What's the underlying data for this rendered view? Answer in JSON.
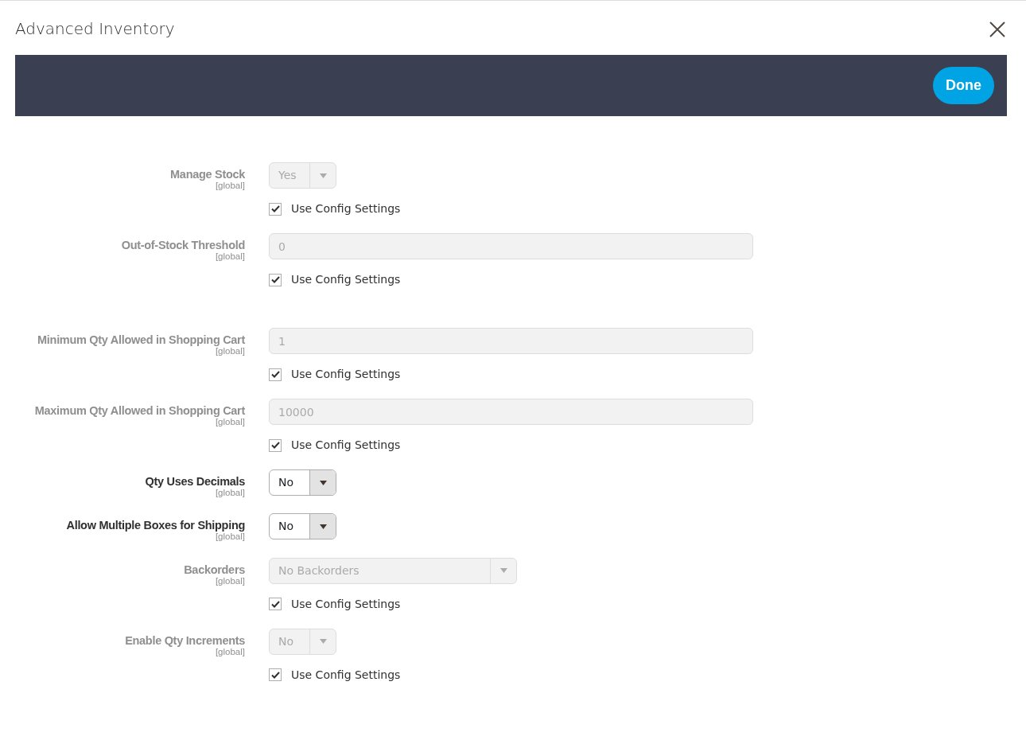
{
  "modal": {
    "title": "Advanced Inventory",
    "done_button": "Done"
  },
  "fields": [
    {
      "label": "Manage Stock",
      "scope": "[global]",
      "kind": "select",
      "value": "Yes",
      "disabled": true,
      "use_config": {
        "label": "Use Config Settings",
        "checked": true
      }
    },
    {
      "label": "Out-of-Stock Threshold",
      "scope": "[global]",
      "kind": "text",
      "value": "0",
      "disabled": true,
      "use_config": {
        "label": "Use Config Settings",
        "checked": true
      }
    },
    {
      "label": "Minimum Qty Allowed in Shopping Cart",
      "scope": "[global]",
      "kind": "text",
      "value": "1",
      "disabled": true,
      "use_config": {
        "label": "Use Config Settings",
        "checked": true
      }
    },
    {
      "label": "Maximum Qty Allowed in Shopping Cart",
      "scope": "[global]",
      "kind": "text",
      "value": "10000",
      "disabled": true,
      "use_config": {
        "label": "Use Config Settings",
        "checked": true
      }
    },
    {
      "label": "Qty Uses Decimals",
      "scope": "[global]",
      "kind": "select",
      "value": "No",
      "disabled": false
    },
    {
      "label": "Allow Multiple Boxes for Shipping",
      "scope": "[global]",
      "kind": "select",
      "value": "No",
      "disabled": false
    },
    {
      "label": "Backorders",
      "scope": "[global]",
      "kind": "wide-select",
      "value": "No Backorders",
      "disabled": true,
      "use_config": {
        "label": "Use Config Settings",
        "checked": true
      }
    },
    {
      "label": "Enable Qty Increments",
      "scope": "[global]",
      "kind": "select",
      "value": "No",
      "disabled": true,
      "use_config": {
        "label": "Use Config Settings",
        "checked": true
      }
    }
  ]
}
